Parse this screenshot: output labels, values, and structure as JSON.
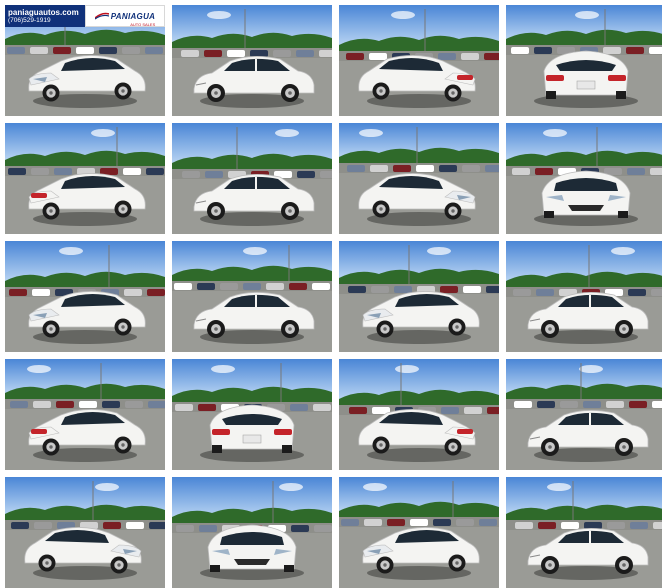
{
  "banner": {
    "site": "paniaguautos.com",
    "phone": "(706)529-1919",
    "brand": "PANIAGUA",
    "brand_sub": "AUTO SALES"
  },
  "colors": {
    "sky": "#4a86d6",
    "sky_light": "#b7d3f2",
    "trees": "#2f6a2a",
    "asphalt": "#8e8f8a",
    "car_body": "#f4f4f2",
    "glass": "#1d2a36",
    "tail_light": "#c4242a",
    "banner_blue": "#10317a"
  },
  "photos": [
    {
      "view": "front-left"
    },
    {
      "view": "side-left"
    },
    {
      "view": "rear-right"
    },
    {
      "view": "rear"
    },
    {
      "view": "rear-left"
    },
    {
      "view": "side-left"
    },
    {
      "view": "front-right"
    },
    {
      "view": "front"
    },
    {
      "view": "front-left"
    },
    {
      "view": "side-left"
    },
    {
      "view": "front-left"
    },
    {
      "view": "side-left"
    },
    {
      "view": "rear-left"
    },
    {
      "view": "rear"
    },
    {
      "view": "rear-right"
    },
    {
      "view": "side-left"
    },
    {
      "view": "front-right"
    },
    {
      "view": "front"
    },
    {
      "view": "front-left"
    },
    {
      "view": "side-left"
    }
  ]
}
